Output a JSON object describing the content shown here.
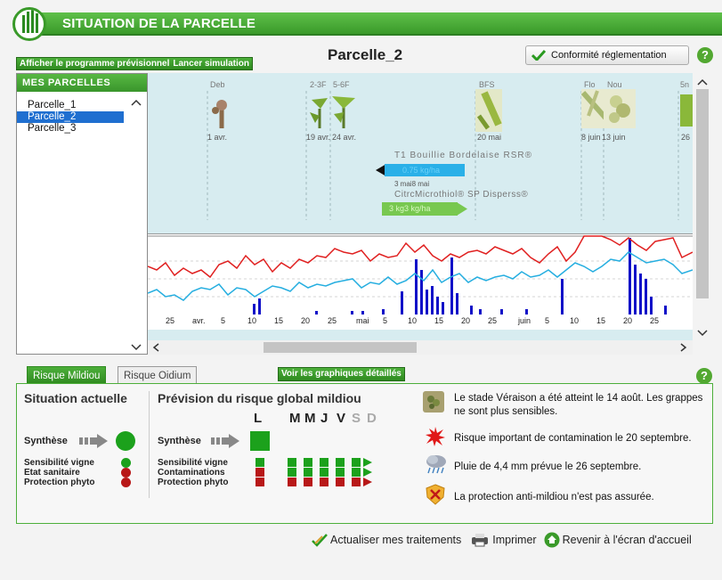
{
  "header": {
    "title": "SITUATION DE LA PARCELLE"
  },
  "toolbar": {
    "show_program_label": "Afficher le programme prévisionnel",
    "launch_sim_label": "Lancer simulation",
    "parcel_title": "Parcelle_2",
    "conformity_label": "Conformité réglementation",
    "help_label": "?"
  },
  "parcels": {
    "header": "MES PARCELLES",
    "items": [
      "Parcelle_1",
      "Parcelle_2",
      "Parcelle_3"
    ],
    "selected_index": 1
  },
  "stages": [
    {
      "label": "Deb",
      "date": "1 avr."
    },
    {
      "label": "2-3F",
      "date": "19 avr."
    },
    {
      "label": "5-6F",
      "date": "24 avr."
    },
    {
      "label": "BFS",
      "date": "20 mai"
    },
    {
      "label": "Flo",
      "date": "8 juin"
    },
    {
      "label": "Nou",
      "date": "13 juin"
    },
    {
      "label": "5n",
      "date": "26"
    }
  ],
  "treatments": [
    {
      "name": "T1  Bouillie Bordelaise RSR®",
      "dose": "0.75 kg/ha",
      "dates": "3 mai8 mai"
    },
    {
      "name": "CitrcMicrothiol® SP Disperss®",
      "dose": "3 kg3 kg/ha"
    }
  ],
  "axis_labels": [
    "25",
    "avr.",
    "5",
    "10",
    "15",
    "20",
    "25",
    "mai",
    "5",
    "10",
    "15",
    "20",
    "25",
    "juin",
    "5",
    "10",
    "15",
    "20",
    "25"
  ],
  "tabs": {
    "mildiou": "Risque Mildiou",
    "oidium": "Risque Oidium",
    "detailed": "Voir les graphiques détaillés"
  },
  "situation": {
    "title": "Situation actuelle",
    "synthese": "Synthèse",
    "rows": [
      "Sensibilité vigne",
      "Etat sanitaire",
      "Protection phyto"
    ],
    "row_status": [
      "green",
      "red",
      "red"
    ]
  },
  "forecast": {
    "title": "Prévision du risque global mildiou",
    "days": [
      "L",
      "M",
      "M",
      "J",
      "V",
      "S",
      "D"
    ],
    "synthese": "Synthèse",
    "rows": [
      "Sensibilité vigne",
      "Contaminations",
      "Protection phyto"
    ]
  },
  "messages": [
    "Le stade Véraison a été atteint le 14 août. Les grappes ne sont plus sensibles.",
    "Risque important de contamination le 20 septembre.",
    "Pluie de 4,4 mm prévue le 26 septembre.",
    "La protection anti-mildiou n'est pas assurée."
  ],
  "footer": {
    "update_label": "Actualiser mes traitements",
    "print_label": "Imprimer",
    "home_label": "Revenir à l'écran d'accueil"
  },
  "colors": {
    "accent": "#3a9a2a",
    "risk_line": "#e02020",
    "temp_line": "#25aee0",
    "rain_bar": "#1010c8",
    "selected": "#1f6fd0"
  }
}
